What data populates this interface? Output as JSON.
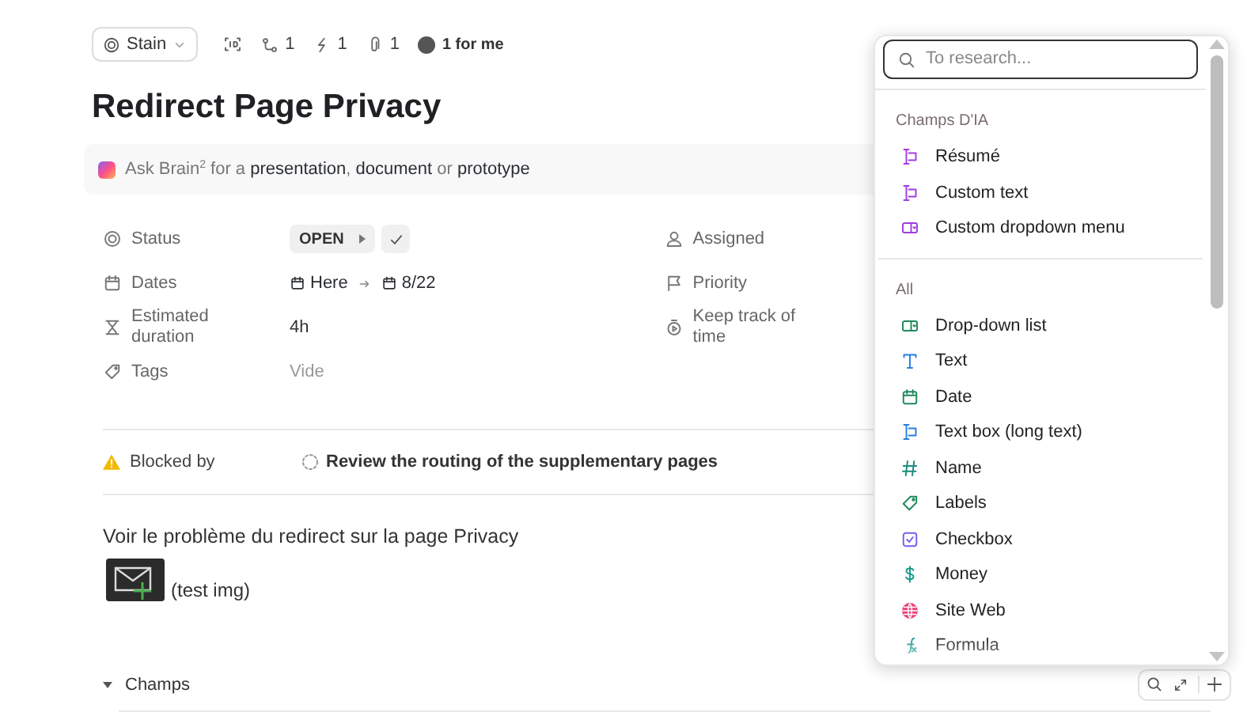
{
  "toolbar": {
    "status_button": "Stain",
    "counts": [
      {
        "kind": "subtasks",
        "count": "1"
      },
      {
        "kind": "links",
        "count": "1"
      },
      {
        "kind": "attachments",
        "count": "1"
      }
    ],
    "assignee_label": "1 for me"
  },
  "title": "Redirect Page Privacy",
  "brain_bar": {
    "prefix": "Ask Brain",
    "sup": "2",
    "middle": " for a ",
    "links": [
      "presentation",
      "document",
      "prototype"
    ],
    "sep1": ", ",
    "sep2": " or "
  },
  "properties_left": [
    {
      "kind": "status",
      "label": "Status",
      "value": "OPEN"
    },
    {
      "kind": "dates",
      "label": "Dates",
      "start": "Here",
      "end": "8/22"
    },
    {
      "kind": "duration",
      "label": "Estimated duration",
      "value": "4h"
    },
    {
      "kind": "tags",
      "label": "Tags",
      "placeholder": "Vide"
    }
  ],
  "properties_right": [
    {
      "kind": "assigned",
      "label": "Assigned"
    },
    {
      "kind": "priority",
      "label": "Priority"
    },
    {
      "kind": "time",
      "label": "Keep track of time"
    }
  ],
  "blocked": {
    "label": "Blocked by",
    "task": "Review the routing of the supplementary pages"
  },
  "description": "Voir le problème du redirect sur la page Privacy",
  "image_caption": "(test img)",
  "section": {
    "label": "Champs",
    "expanded": true
  },
  "popup": {
    "search_placeholder": "To research...",
    "groups": [
      {
        "title": "Champs D'IA",
        "items": [
          {
            "kind": "ai-text",
            "label": "Résumé"
          },
          {
            "kind": "ai-text",
            "label": "Custom text"
          },
          {
            "kind": "ai-dropdown",
            "label": "Custom dropdown menu"
          }
        ]
      },
      {
        "title": "All",
        "items": [
          {
            "kind": "dropdown",
            "label": "Drop-down list"
          },
          {
            "kind": "text",
            "label": "Text"
          },
          {
            "kind": "date",
            "label": "Date"
          },
          {
            "kind": "longtext",
            "label": "Text box (long text)"
          },
          {
            "kind": "number",
            "label": "Name"
          },
          {
            "kind": "labels",
            "label": "Labels"
          },
          {
            "kind": "checkbox",
            "label": "Checkbox"
          },
          {
            "kind": "money",
            "label": "Money"
          },
          {
            "kind": "web",
            "label": "Site Web"
          },
          {
            "kind": "formula",
            "label": "Formula"
          }
        ]
      }
    ]
  }
}
